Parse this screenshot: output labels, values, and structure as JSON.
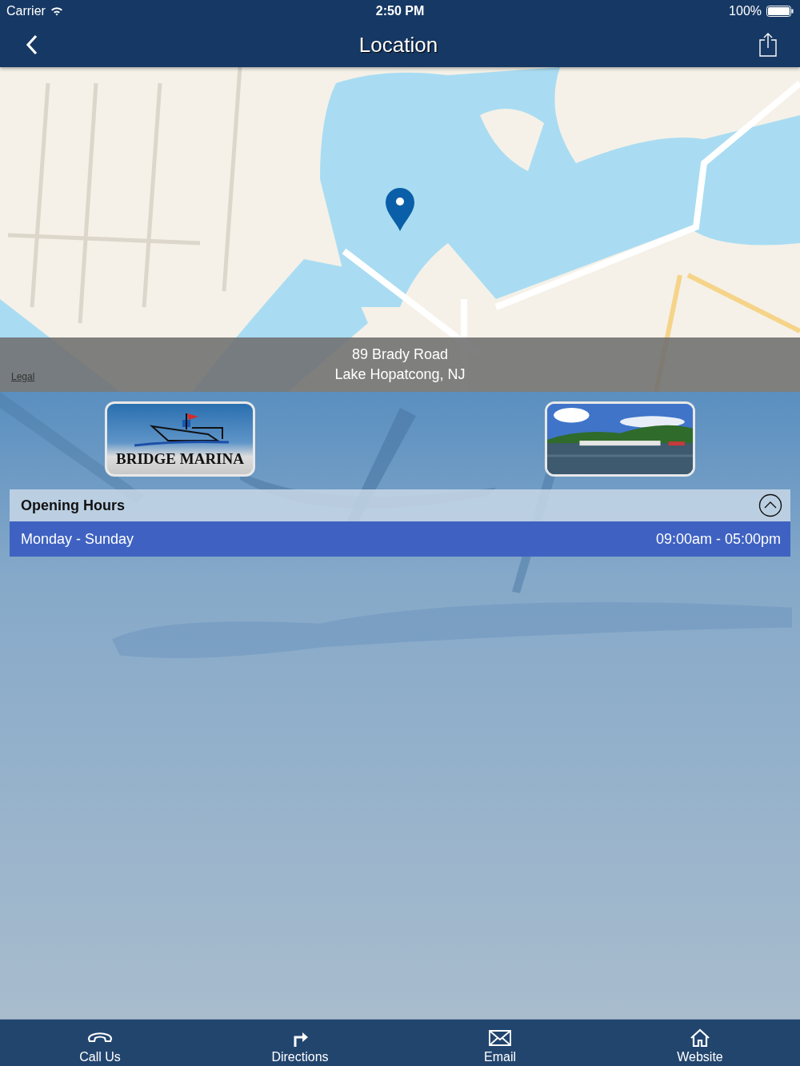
{
  "status_bar": {
    "carrier": "Carrier",
    "time": "2:50 PM",
    "battery": "100%"
  },
  "nav": {
    "title": "Location"
  },
  "map": {
    "address_lines": [
      "89 Brady Road",
      "Lake Hopatcong, NJ"
    ],
    "legal": "Legal"
  },
  "thumbnails": [
    {
      "kind": "logo",
      "text": "BRIDGE MARINA"
    },
    {
      "kind": "picture"
    }
  ],
  "hours": {
    "title": "Opening Hours",
    "expanded": true,
    "rows": [
      {
        "days": "Monday - Sunday",
        "time": "09:00am - 05:00pm"
      }
    ]
  },
  "tab_bar": [
    {
      "kind": "phone",
      "label": "Call Us"
    },
    {
      "kind": "directions",
      "label": "Directions"
    },
    {
      "kind": "mail",
      "label": "Email"
    },
    {
      "kind": "home",
      "label": "Website"
    }
  ]
}
